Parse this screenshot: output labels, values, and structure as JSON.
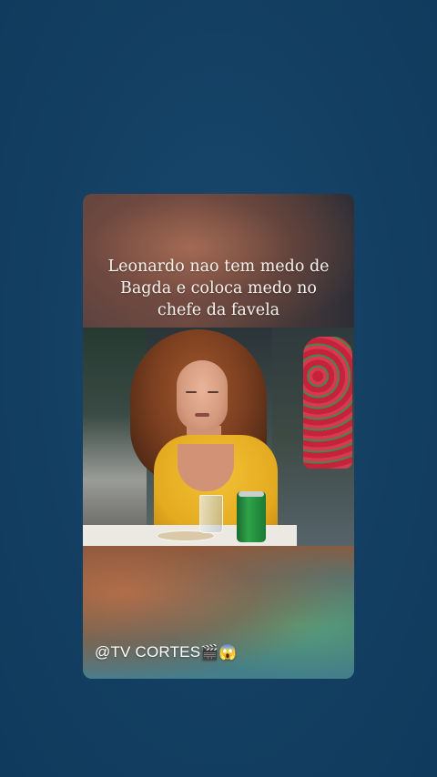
{
  "story": {
    "caption_lines": [
      "Leonardo nao tem medo de",
      "Bagda e coloca medo no",
      "chefe da favela"
    ],
    "handle": "@TV CORTES",
    "handle_emojis": "🎬😱"
  },
  "icons": [
    "clapper-board-icon",
    "screaming-face-icon"
  ],
  "colors": {
    "background": "#133f62",
    "caption_text": "#f5f2ee",
    "handle_text": "#ffffff"
  }
}
